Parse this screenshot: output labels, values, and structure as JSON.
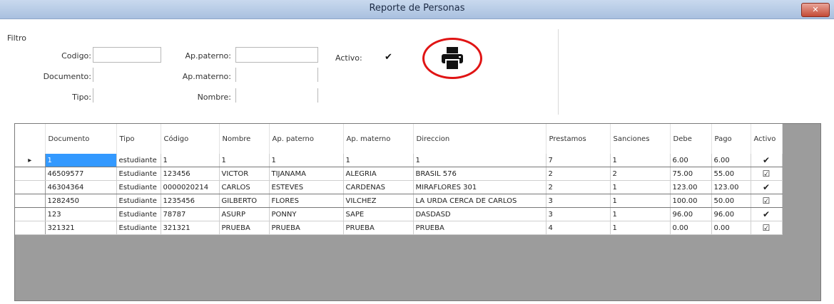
{
  "window": {
    "title": "Reporte de Personas",
    "close_label": "Cerrar"
  },
  "filter": {
    "group_label": "Filtro",
    "codigo_label": "Codigo:",
    "documento_label": "Documento:",
    "tipo_label": "Tipo:",
    "ap_paterno_label": "Ap.paterno:",
    "ap_materno_label": "Ap.materno:",
    "nombre_label": "Nombre:",
    "activo_label": "Activo:",
    "activo_checked": "✔"
  },
  "grid": {
    "columns": [
      "Documento",
      "Tipo",
      "Código",
      "Nombre",
      "Ap. paterno",
      "Ap. materno",
      "Direccion",
      "Prestamos",
      "Sanciones",
      "Debe",
      "Pago",
      "Activo"
    ],
    "rows": [
      {
        "indicator": "▸",
        "cells": [
          "1",
          "estudiante",
          "1",
          "1",
          "1",
          "1",
          "1",
          "7",
          "1",
          "6.00",
          "6.00"
        ],
        "activo": "✔"
      },
      {
        "indicator": "",
        "cells": [
          "46509577",
          "Estudiante",
          "123456",
          "VICTOR",
          "TIJANAMA",
          "ALEGRIA",
          "BRASIL 576",
          "2",
          "2",
          "75.00",
          "55.00"
        ],
        "activo": "☑"
      },
      {
        "indicator": "",
        "cells": [
          "46304364",
          "Estudiante",
          "0000020214",
          "CARLOS",
          "ESTEVES",
          "CARDENAS",
          "MIRAFLORES 301",
          "2",
          "1",
          "123.00",
          "123.00"
        ],
        "activo": "✔"
      },
      {
        "indicator": "",
        "cells": [
          "1282450",
          "Estudiante",
          "1235456",
          "GILBERTO",
          "FLORES",
          "VILCHEZ",
          "LA URDA CERCA DE CARLOS",
          "3",
          "1",
          "100.00",
          "50.00"
        ],
        "activo": "☑"
      },
      {
        "indicator": "",
        "cells": [
          "123",
          "Estudiante",
          "78787",
          "ASURP",
          "PONNY",
          "SAPE",
          "DASDASD",
          "3",
          "1",
          "96.00",
          "96.00"
        ],
        "activo": "✔"
      },
      {
        "indicator": "",
        "cells": [
          "321321",
          "Estudiante",
          "321321",
          "PRUEBA",
          "PRUEBA",
          "PRUEBA",
          "PRUEBA",
          "4",
          "1",
          "0.00",
          "0.00"
        ],
        "activo": "☑"
      }
    ]
  },
  "colors": {
    "selection": "#3399ff",
    "print_circle": "#e01414",
    "grid_bg": "#9c9c9c"
  }
}
